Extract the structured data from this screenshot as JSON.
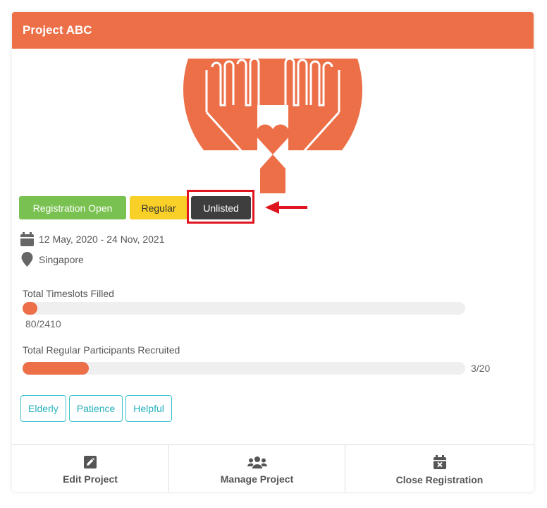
{
  "header": {
    "title": "Project ABC"
  },
  "badges": {
    "registration": "Registration Open",
    "type": "Regular",
    "visibility": "Unlisted"
  },
  "meta": {
    "date_range": "12 May, 2020 - 24 Nov, 2021",
    "location": "Singapore"
  },
  "progress": {
    "timeslots": {
      "label": "Total Timeslots Filled",
      "value_text": "80/2410",
      "filled": 80,
      "total": 2410
    },
    "participants": {
      "label": "Total Regular Participants Recruited",
      "value_text": "3/20",
      "filled": 3,
      "total": 20
    }
  },
  "tags": [
    "Elderly",
    "Patience",
    "Helpful"
  ],
  "footer": {
    "edit": "Edit Project",
    "manage": "Manage Project",
    "close": "Close Registration"
  },
  "colors": {
    "accent": "#ec6f48",
    "registration_open": "#79c150",
    "regular": "#f8d028",
    "unlisted": "#3e3e3e",
    "tag": "#3cc3cf",
    "annotation": "#e0151f"
  },
  "icons": {
    "date": "calendar-icon",
    "location": "map-marker-icon",
    "edit": "pencil-square-icon",
    "manage": "users-group-icon",
    "close": "calendar-close-icon"
  }
}
